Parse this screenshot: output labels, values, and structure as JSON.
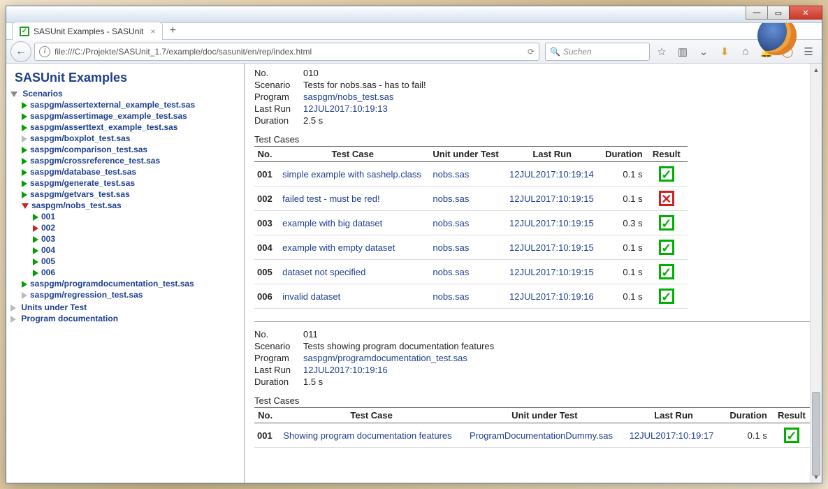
{
  "window": {
    "tab_title": "SASUnit Examples - SASUnit",
    "url": "file:///C:/Projekte/SASUnit_1.7/example/doc/sasunit/en/rep/index.html",
    "search_placeholder": "Suchen"
  },
  "sidebar": {
    "title": "SASUnit Examples",
    "root": "Scenarios",
    "items": [
      {
        "marker": "green",
        "label": "saspgm/assertexternal_example_test.sas"
      },
      {
        "marker": "green",
        "label": "saspgm/assertimage_example_test.sas"
      },
      {
        "marker": "green",
        "label": "saspgm/asserttext_example_test.sas"
      },
      {
        "marker": "gray",
        "label": "saspgm/boxplot_test.sas"
      },
      {
        "marker": "green",
        "label": "saspgm/comparison_test.sas"
      },
      {
        "marker": "green",
        "label": "saspgm/crossreference_test.sas"
      },
      {
        "marker": "green",
        "label": "saspgm/database_test.sas"
      },
      {
        "marker": "green",
        "label": "saspgm/generate_test.sas"
      },
      {
        "marker": "green",
        "label": "saspgm/getvars_test.sas"
      }
    ],
    "active": {
      "label": "saspgm/nobs_test.sas",
      "children": [
        {
          "marker": "green",
          "label": "001"
        },
        {
          "marker": "red",
          "label": "002"
        },
        {
          "marker": "green",
          "label": "003"
        },
        {
          "marker": "green",
          "label": "004"
        },
        {
          "marker": "green",
          "label": "005"
        },
        {
          "marker": "green",
          "label": "006"
        }
      ]
    },
    "items_after": [
      {
        "marker": "green",
        "label": "saspgm/programdocumentation_test.sas"
      },
      {
        "marker": "gray",
        "label": "saspgm/regression_test.sas"
      }
    ],
    "bottom": [
      {
        "label": "Units under Test"
      },
      {
        "label": "Program documentation"
      }
    ]
  },
  "scenario1": {
    "labels": {
      "no": "No.",
      "scenario": "Scenario",
      "program": "Program",
      "lastrun": "Last Run",
      "duration": "Duration",
      "cases": "Test Cases"
    },
    "no": "010",
    "scenario": "Tests for nobs.sas - has to fail!",
    "program": "saspgm/nobs_test.sas",
    "lastrun": "12JUL2017:10:19:13",
    "duration": "2.5 s",
    "headers": {
      "no": "No.",
      "tc": "Test Case",
      "uut": "Unit under Test",
      "lr": "Last Run",
      "dur": "Duration",
      "res": "Result"
    },
    "rows": [
      {
        "no": "001",
        "tc": "simple example with sashelp.class",
        "uut": "nobs.sas",
        "lr": "12JUL2017:10:19:14",
        "dur": "0.1 s",
        "pass": true
      },
      {
        "no": "002",
        "tc": "failed test - must be red!",
        "uut": "nobs.sas",
        "lr": "12JUL2017:10:19:15",
        "dur": "0.1 s",
        "pass": false
      },
      {
        "no": "003",
        "tc": "example with big dataset",
        "uut": "nobs.sas",
        "lr": "12JUL2017:10:19:15",
        "dur": "0.3 s",
        "pass": true
      },
      {
        "no": "004",
        "tc": "example with empty dataset",
        "uut": "nobs.sas",
        "lr": "12JUL2017:10:19:15",
        "dur": "0.1 s",
        "pass": true
      },
      {
        "no": "005",
        "tc": "dataset not specified",
        "uut": "nobs.sas",
        "lr": "12JUL2017:10:19:15",
        "dur": "0.1 s",
        "pass": true
      },
      {
        "no": "006",
        "tc": "invalid dataset",
        "uut": "nobs.sas",
        "lr": "12JUL2017:10:19:16",
        "dur": "0.1 s",
        "pass": true
      }
    ]
  },
  "scenario2": {
    "no": "011",
    "scenario": "Tests showing program documentation features",
    "program": "saspgm/programdocumentation_test.sas",
    "lastrun": "12JUL2017:10:19:16",
    "duration": "1.5 s",
    "rows": [
      {
        "no": "001",
        "tc": "Showing program documentation features",
        "uut": "ProgramDocumentationDummy.sas",
        "lr": "12JUL2017:10:19:17",
        "dur": "0.1 s",
        "pass": true
      }
    ]
  }
}
